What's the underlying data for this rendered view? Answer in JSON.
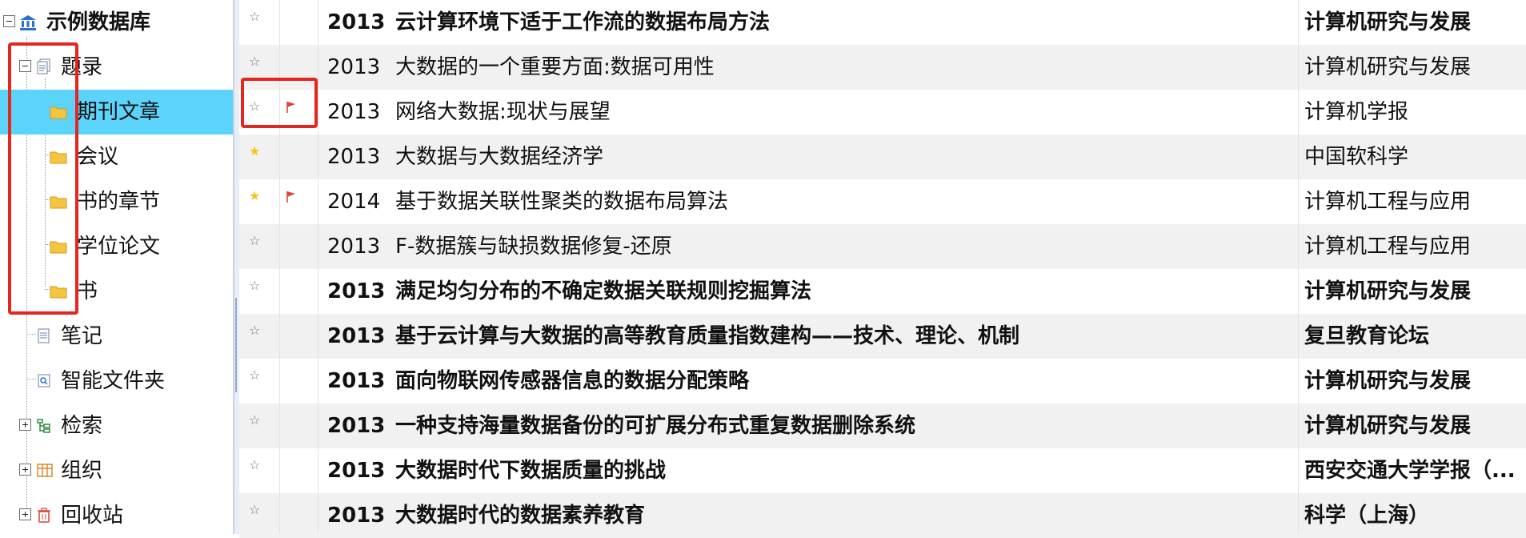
{
  "tree": {
    "root": {
      "label": "示例数据库",
      "icon": "library-icon",
      "expanded": true
    },
    "nodes": [
      {
        "label": "题录",
        "icon": "records-icon",
        "expanded": true
      },
      {
        "label": "期刊文章",
        "icon": "folder-icon",
        "selected": true
      },
      {
        "label": "会议",
        "icon": "folder-icon"
      },
      {
        "label": "书的章节",
        "icon": "folder-icon"
      },
      {
        "label": "学位论文",
        "icon": "folder-icon"
      },
      {
        "label": "书",
        "icon": "folder-icon"
      },
      {
        "label": "笔记",
        "icon": "note-icon"
      },
      {
        "label": "智能文件夹",
        "icon": "smart-folder-icon"
      },
      {
        "label": "检索",
        "icon": "search-tree-icon",
        "expanded": false
      },
      {
        "label": "组织",
        "icon": "organize-icon",
        "expanded": false
      },
      {
        "label": "回收站",
        "icon": "trash-icon",
        "expanded": false
      }
    ]
  },
  "list": {
    "rows": [
      {
        "starred": false,
        "flagged": false,
        "year": "2013",
        "title": "云计算环境下适于工作流的数据布局方法",
        "publication": "计算机研究与发展",
        "unread": true
      },
      {
        "starred": false,
        "flagged": false,
        "year": "2013",
        "title": "大数据的一个重要方面:数据可用性",
        "publication": "计算机研究与发展",
        "unread": false
      },
      {
        "starred": false,
        "flagged": true,
        "year": "2013",
        "title": "网络大数据:现状与展望",
        "publication": "计算机学报",
        "unread": false
      },
      {
        "starred": true,
        "flagged": false,
        "year": "2013",
        "title": "大数据与大数据经济学",
        "publication": "中国软科学",
        "unread": false
      },
      {
        "starred": true,
        "flagged": true,
        "year": "2014",
        "title": "基于数据关联性聚类的数据布局算法",
        "publication": "计算机工程与应用",
        "unread": false
      },
      {
        "starred": false,
        "flagged": false,
        "year": "2013",
        "title": "F-数据簇与缺损数据修复-还原",
        "publication": "计算机工程与应用",
        "unread": false
      },
      {
        "starred": false,
        "flagged": false,
        "year": "2013",
        "title": "满足均匀分布的不确定数据关联规则挖掘算法",
        "publication": "计算机研究与发展",
        "unread": true
      },
      {
        "starred": false,
        "flagged": false,
        "year": "2013",
        "title": "基于云计算与大数据的高等教育质量指数建构——技术、理论、机制",
        "publication": "复旦教育论坛",
        "unread": true
      },
      {
        "starred": false,
        "flagged": false,
        "year": "2013",
        "title": "面向物联网传感器信息的数据分配策略",
        "publication": "计算机研究与发展",
        "unread": true
      },
      {
        "starred": false,
        "flagged": false,
        "year": "2013",
        "title": "一种支持海量数据备份的可扩展分布式重复数据删除系统",
        "publication": "计算机研究与发展",
        "unread": true
      },
      {
        "starred": false,
        "flagged": false,
        "year": "2013",
        "title": "大数据时代下数据质量的挑战",
        "publication": "西安交通大学学报（...",
        "unread": true
      },
      {
        "starred": false,
        "flagged": false,
        "year": "2013",
        "title": "大数据时代的数据素养教育",
        "publication": "科学（上海）",
        "unread": true
      }
    ]
  },
  "glyphs": {
    "star_empty": "☆",
    "star_filled": "★"
  },
  "colors": {
    "selection": "#5cd3fb",
    "highlight_box": "#e5261f",
    "flag": "#d9443b",
    "star": "#f5c518",
    "folder": "#f5c542",
    "alt_row": "#f1f1f1"
  }
}
